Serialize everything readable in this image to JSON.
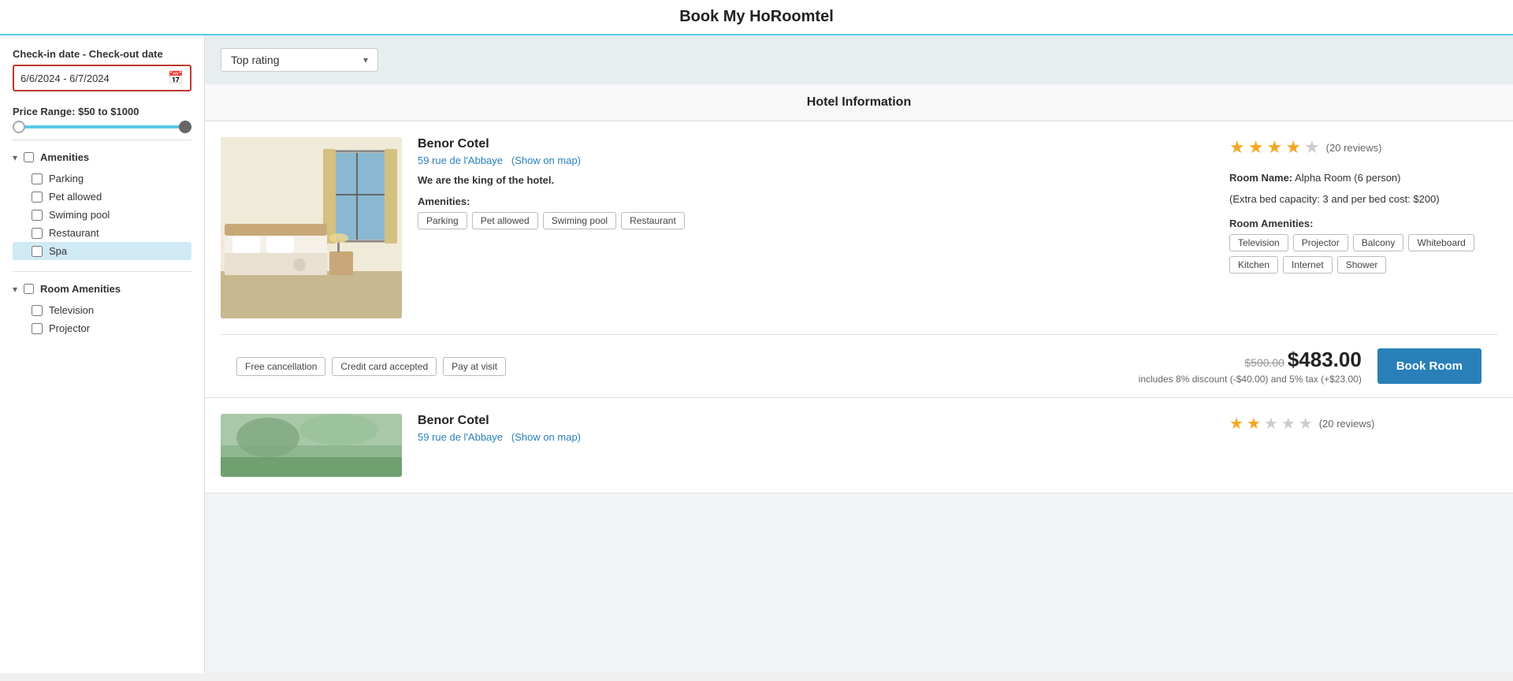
{
  "header": {
    "title": "Book My HoRoomtel"
  },
  "sidebar": {
    "date_label": "Check-in date - Check-out date",
    "date_value": "6/6/2024 - 6/7/2024",
    "price_range_label": "Price Range: $50 to $1000",
    "amenities_section": {
      "label": "Amenities",
      "items": [
        {
          "id": "parking",
          "label": "Parking",
          "checked": false
        },
        {
          "id": "pet-allowed",
          "label": "Pet allowed",
          "checked": false
        },
        {
          "id": "swiming-pool",
          "label": "Swiming pool",
          "checked": false
        },
        {
          "id": "restaurant",
          "label": "Restaurant",
          "checked": false
        },
        {
          "id": "spa",
          "label": "Spa",
          "checked": false,
          "active": true
        }
      ]
    },
    "room_amenities_section": {
      "label": "Room Amenities",
      "items": [
        {
          "id": "television",
          "label": "Television",
          "checked": false
        },
        {
          "id": "projector",
          "label": "Projector",
          "checked": false
        }
      ]
    }
  },
  "sort": {
    "label": "Top rating",
    "dropdown_arrow": "▾"
  },
  "content": {
    "section_title": "Hotel Information",
    "hotels": [
      {
        "id": 1,
        "name": "Benor Cotel",
        "address": "59 rue de l'Abbaye",
        "show_map_text": "(Show on map)",
        "description": "We are the king of the hotel.",
        "amenities_label": "Amenities:",
        "amenities": [
          "Parking",
          "Pet allowed",
          "Swiming pool",
          "Restaurant"
        ],
        "stars_filled": 4,
        "stars_empty": 1,
        "reviews": "(20 reviews)",
        "room_name_label": "Room Name:",
        "room_name": "Alpha Room (6 person)",
        "extra_bed_info": "(Extra bed capacity: 3 and per bed cost: $200)",
        "room_amenities_label": "Room Amenities:",
        "room_amenities": [
          "Television",
          "Projector",
          "Balcony",
          "Whiteboard",
          "Kitchen",
          "Internet",
          "Shower"
        ],
        "policies": [
          "Free cancellation",
          "Credit card accepted",
          "Pay at visit"
        ],
        "original_price": "$500.00",
        "discounted_price": "$483.00",
        "discount_info": "includes 8% discount (-$40.00) and 5% tax (+$23.00)",
        "book_button": "Book Room"
      },
      {
        "id": 2,
        "name": "Benor Cotel",
        "address": "59 rue de l'Abbaye",
        "show_map_text": "(Show on map)",
        "stars_filled": 2,
        "stars_empty": 3,
        "reviews": "(20 reviews)"
      }
    ]
  }
}
